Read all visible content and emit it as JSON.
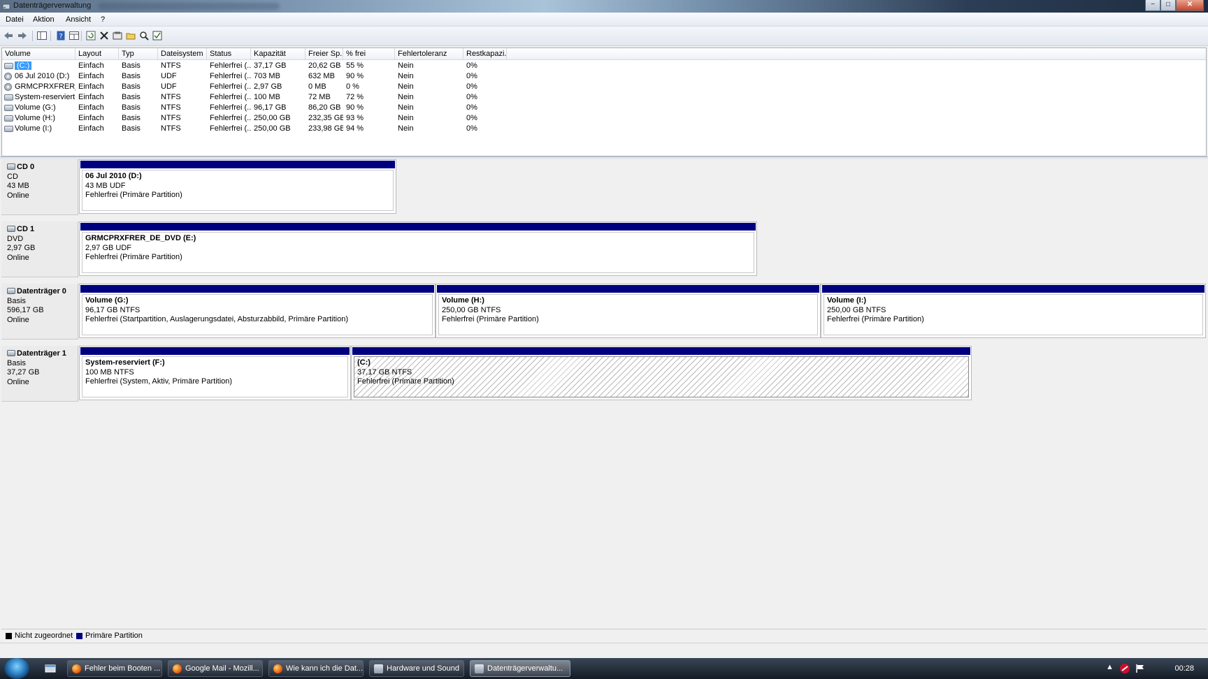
{
  "window": {
    "title": "Datenträgerverwaltung",
    "controls": {
      "minimize": "−",
      "maximize": "□",
      "close": "✕"
    }
  },
  "menu": [
    "Datei",
    "Aktion",
    "Ansicht",
    "?"
  ],
  "toolbar": {
    "icons": [
      "back-icon",
      "forward-icon",
      "console-tree-icon",
      "help-icon",
      "view-icon",
      "refresh-icon",
      "delete-icon",
      "properties-icon",
      "open-icon",
      "explore-icon",
      "checklist-icon"
    ]
  },
  "volume_table": {
    "headers": [
      "Volume",
      "Layout",
      "Typ",
      "Dateisystem",
      "Status",
      "Kapazität",
      "Freier Sp...",
      "% frei",
      "Fehlertoleranz",
      "Restkapazi..."
    ],
    "rows": [
      [
        "(C:)",
        "Einfach",
        "Basis",
        "NTFS",
        "Fehlerfrei (...",
        "37,17 GB",
        "20,62 GB",
        "55 %",
        "Nein",
        "0%"
      ],
      [
        "06 Jul 2010 (D:)",
        "Einfach",
        "Basis",
        "UDF",
        "Fehlerfrei (...",
        "703 MB",
        "632 MB",
        "90 %",
        "Nein",
        "0%"
      ],
      [
        "GRMCPRXFRER_D...",
        "Einfach",
        "Basis",
        "UDF",
        "Fehlerfrei (...",
        "2,97 GB",
        "0 MB",
        "0 %",
        "Nein",
        "0%"
      ],
      [
        "System-reserviert (...",
        "Einfach",
        "Basis",
        "NTFS",
        "Fehlerfrei (...",
        "100 MB",
        "72 MB",
        "72 %",
        "Nein",
        "0%"
      ],
      [
        "Volume (G:)",
        "Einfach",
        "Basis",
        "NTFS",
        "Fehlerfrei (...",
        "96,17 GB",
        "86,20 GB",
        "90 %",
        "Nein",
        "0%"
      ],
      [
        "Volume (H:)",
        "Einfach",
        "Basis",
        "NTFS",
        "Fehlerfrei (...",
        "250,00 GB",
        "232,35 GB",
        "93 %",
        "Nein",
        "0%"
      ],
      [
        "Volume (I:)",
        "Einfach",
        "Basis",
        "NTFS",
        "Fehlerfrei (...",
        "250,00 GB",
        "233,98 GB",
        "94 %",
        "Nein",
        "0%"
      ]
    ]
  },
  "disks": [
    {
      "name": "CD 0",
      "type": "CD",
      "size": "43 MB",
      "status": "Online",
      "partitions": [
        {
          "name": "06 Jul 2010  (D:)",
          "size": "43 MB UDF",
          "status": "Fehlerfrei (Primäre Partition)"
        }
      ]
    },
    {
      "name": "CD 1",
      "type": "DVD",
      "size": "2,97 GB",
      "status": "Online",
      "partitions": [
        {
          "name": "GRMCPRXFRER_DE_DVD  (E:)",
          "size": "2,97 GB UDF",
          "status": "Fehlerfrei (Primäre Partition)"
        }
      ]
    },
    {
      "name": "Datenträger 0",
      "type": "Basis",
      "size": "596,17 GB",
      "status": "Online",
      "partitions": [
        {
          "name": "Volume  (G:)",
          "size": "96,17 GB NTFS",
          "status": "Fehlerfrei (Startpartition, Auslagerungsdatei, Absturzabbild, Primäre Partition)"
        },
        {
          "name": "Volume  (H:)",
          "size": "250,00 GB NTFS",
          "status": "Fehlerfrei (Primäre Partition)"
        },
        {
          "name": "Volume  (I:)",
          "size": "250,00 GB NTFS",
          "status": "Fehlerfrei (Primäre Partition)"
        }
      ]
    },
    {
      "name": "Datenträger 1",
      "type": "Basis",
      "size": "37,27 GB",
      "status": "Online",
      "partitions": [
        {
          "name": "System-reserviert  (F:)",
          "size": "100 MB NTFS",
          "status": "Fehlerfrei (System, Aktiv, Primäre Partition)"
        },
        {
          "name": "(C:)",
          "size": "37,17 GB NTFS",
          "status": "Fehlerfrei (Primäre Partition)"
        }
      ]
    }
  ],
  "legend": {
    "unallocated": {
      "label": "Nicht zugeordnet",
      "color": "#000000"
    },
    "primary": {
      "label": "Primäre Partition",
      "color": "#00007f"
    }
  },
  "taskbar": {
    "buttons": [
      "Fehler beim Booten ...",
      "Google Mail - Mozill...",
      "Wie kann ich die Dat...",
      "Hardware und Sound",
      "Datenträgerverwaltu..."
    ],
    "clock": "00:28"
  }
}
